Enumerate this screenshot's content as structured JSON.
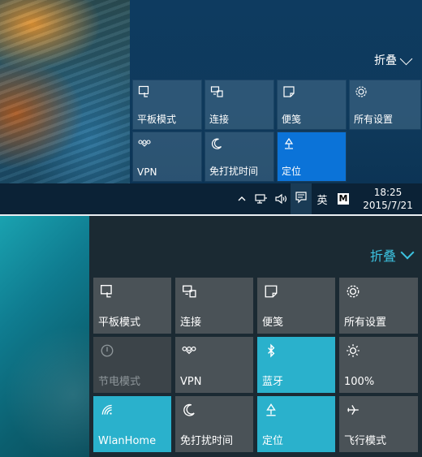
{
  "top": {
    "collapse_label": "折叠",
    "tiles": [
      {
        "label": "平板模式",
        "icon": "tablet-mode-icon"
      },
      {
        "label": "连接",
        "icon": "connect-icon"
      },
      {
        "label": "便笺",
        "icon": "note-icon"
      },
      {
        "label": "所有设置",
        "icon": "settings-gear-icon"
      },
      {
        "label": "VPN",
        "icon": "vpn-icon"
      },
      {
        "label": "免打扰时间",
        "icon": "quiet-hours-moon-icon"
      },
      {
        "label": "定位",
        "icon": "location-icon",
        "state": "on"
      }
    ],
    "taskbar": {
      "ime": "英",
      "m_badge": "M",
      "time": "18:25",
      "date": "2015/7/21"
    }
  },
  "bottom": {
    "collapse_label": "折叠",
    "tiles": [
      {
        "label": "平板模式",
        "icon": "tablet-mode-icon"
      },
      {
        "label": "连接",
        "icon": "connect-icon"
      },
      {
        "label": "便笺",
        "icon": "note-icon"
      },
      {
        "label": "所有设置",
        "icon": "settings-gear-icon"
      },
      {
        "label": "节电模式",
        "icon": "battery-saver-icon",
        "state": "disabled"
      },
      {
        "label": "VPN",
        "icon": "vpn-icon"
      },
      {
        "label": "蓝牙",
        "icon": "bluetooth-icon",
        "state": "on"
      },
      {
        "label": "100%",
        "icon": "brightness-sun-icon"
      },
      {
        "label": "WlanHome",
        "icon": "wifi-icon",
        "state": "on"
      },
      {
        "label": "免打扰时间",
        "icon": "quiet-hours-moon-icon"
      },
      {
        "label": "定位",
        "icon": "location-icon",
        "state": "on"
      },
      {
        "label": "飞行模式",
        "icon": "airplane-icon"
      }
    ]
  },
  "colors": {
    "accent_top_active": "#0b73d8",
    "accent_bottom_on": "#2ab1cc",
    "collapse_bottom": "#3cc2e0"
  }
}
